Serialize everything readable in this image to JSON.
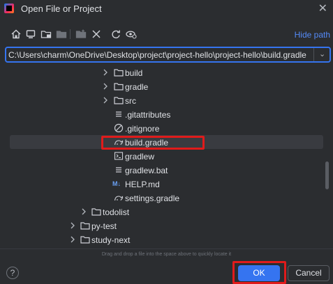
{
  "window": {
    "title": "Open File or Project"
  },
  "toolbar": {
    "icons": [
      "home-icon",
      "desktop-icon",
      "project-folder-icon",
      "module-folder-icon",
      "new-folder-icon",
      "delete-icon",
      "refresh-icon",
      "show-hidden-icon"
    ],
    "hide_path_label": "Hide path"
  },
  "path": {
    "value": "C:\\Users\\charm\\OneDrive\\Desktop\\project\\project-hello\\project-hello\\build.gradle"
  },
  "tree": {
    "items": [
      {
        "label": "build",
        "type": "folder",
        "expandable": true
      },
      {
        "label": "gradle",
        "type": "folder",
        "expandable": true
      },
      {
        "label": "src",
        "type": "folder",
        "expandable": true
      },
      {
        "label": ".gitattributes",
        "type": "text-file",
        "expandable": false
      },
      {
        "label": ".gitignore",
        "type": "ignore-file",
        "expandable": false
      },
      {
        "label": "build.gradle",
        "type": "gradle-file",
        "expandable": false,
        "selected": true
      },
      {
        "label": "gradlew",
        "type": "script-file",
        "expandable": false
      },
      {
        "label": "gradlew.bat",
        "type": "text-file",
        "expandable": false
      },
      {
        "label": "HELP.md",
        "type": "markdown-file",
        "expandable": false
      },
      {
        "label": "settings.gradle",
        "type": "gradle-file",
        "expandable": false
      },
      {
        "label": "todolist",
        "type": "folder",
        "expandable": true
      },
      {
        "label": "py-test",
        "type": "folder",
        "expandable": true
      },
      {
        "label": "study-next",
        "type": "folder",
        "expandable": true
      }
    ],
    "md_badge": "M↓"
  },
  "hint": {
    "text": "Drag and drop a file into the space above to quickly locate it"
  },
  "buttons": {
    "help": "?",
    "ok": "OK",
    "cancel": "Cancel"
  },
  "colors": {
    "background": "#2b2d30",
    "accent": "#3574f0",
    "link": "#548af7",
    "highlight": "#e01b1b",
    "selection": "#393b40"
  }
}
